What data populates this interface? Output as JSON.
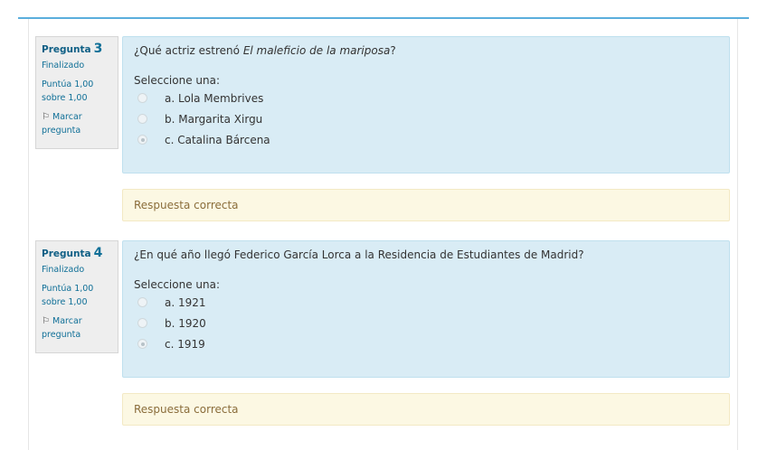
{
  "questions": [
    {
      "label": "Pregunta",
      "number": "3",
      "state": "Finalizado",
      "grade_line1": "Puntúa 1,00",
      "grade_line2": "sobre 1,00",
      "flag_line1": "Marcar",
      "flag_line2": "pregunta",
      "qtext_before": "¿Qué actriz estrenó ",
      "qtext_em": "El maleficio de la mariposa",
      "qtext_after": "?",
      "prompt": "Seleccione una:",
      "answers": [
        {
          "text": "a. Lola Membrives",
          "checked": false
        },
        {
          "text": "b. Margarita Xirgu",
          "checked": false
        },
        {
          "text": "c. Catalina Bárcena",
          "checked": true
        }
      ],
      "feedback": "Respuesta correcta"
    },
    {
      "label": "Pregunta",
      "number": "4",
      "state": "Finalizado",
      "grade_line1": "Puntúa 1,00",
      "grade_line2": "sobre 1,00",
      "flag_line1": "Marcar",
      "flag_line2": "pregunta",
      "qtext_before": "¿En qué año llegó Federico García Lorca a la Residencia de Estudiantes de Madrid?",
      "qtext_em": "",
      "qtext_after": "",
      "prompt": "Seleccione una:",
      "answers": [
        {
          "text": "a. 1921",
          "checked": false
        },
        {
          "text": "b. 1920",
          "checked": false
        },
        {
          "text": "c. 1919",
          "checked": true
        }
      ],
      "feedback": "Respuesta correcta"
    }
  ],
  "colors": {
    "accent": "#5aaedc",
    "formulation_bg": "#d9ecf5",
    "feedback_bg": "#fcf8e3",
    "feedback_text": "#8a6d3b",
    "info_text": "#0f6f97"
  },
  "icons": {
    "flag": "flag-icon",
    "radio": "radio-icon"
  }
}
